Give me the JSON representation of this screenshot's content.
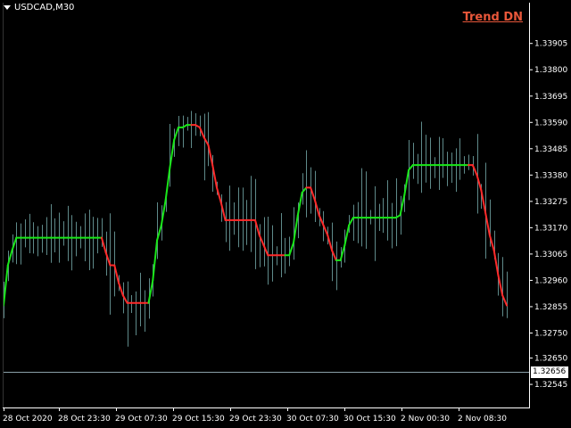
{
  "header": {
    "symbol": "USDCAD,M30"
  },
  "indicator": {
    "label": "Trend DN",
    "label_color": "#e8573a"
  },
  "colors": {
    "background": "#000000",
    "bars": "#5f8a8a",
    "trend_up": "#19e619",
    "trend_down": "#ff2a2a",
    "axis": "#ffffff",
    "bid_line": "#8aa0a8"
  },
  "current_price": "1.32656",
  "chart_data": {
    "type": "line",
    "title": "",
    "xlabel": "",
    "ylabel": "",
    "ylim": [
      1.3246,
      1.34
    ],
    "y_ticks": [
      "1.33905",
      "1.33800",
      "1.33695",
      "1.33590",
      "1.33485",
      "1.33380",
      "1.33275",
      "1.33170",
      "1.33065",
      "1.32960",
      "1.32855",
      "1.32750",
      "1.32650",
      "1.32545"
    ],
    "x_ticks": [
      "28 Oct 2020",
      "28 Oct 23:30",
      "29 Oct 07:30",
      "29 Oct 15:30",
      "29 Oct 23:30",
      "30 Oct 07:30",
      "30 Oct 15:30",
      "2 Nov 00:30",
      "2 Nov 08:30"
    ],
    "series": [
      {
        "values": [
          1.3286,
          1.3302,
          1.3308,
          1.3313,
          1.3313,
          1.3313,
          1.3313,
          1.3313,
          1.3313,
          1.3313,
          1.3313,
          1.3313,
          1.3313,
          1.3313,
          1.3313,
          1.3313,
          1.3313,
          1.3313,
          1.3313,
          1.3313,
          1.3313,
          1.3313,
          1.3313,
          1.3313,
          1.3307,
          1.3302,
          1.3302,
          1.3295,
          1.329,
          1.3287,
          1.3287,
          1.3287,
          1.3287,
          1.3287,
          1.3287,
          1.3296,
          1.3312,
          1.3318,
          1.3328,
          1.3341,
          1.3352,
          1.3357,
          1.3357,
          1.3358,
          1.3358,
          1.3358,
          1.3357,
          1.3353,
          1.335,
          1.3342,
          1.3333,
          1.3327,
          1.332,
          1.332,
          1.332,
          1.332,
          1.332,
          1.332,
          1.332,
          1.332,
          1.3314,
          1.331,
          1.3306,
          1.3306,
          1.3306,
          1.3306,
          1.3306,
          1.3306,
          1.3311,
          1.3322,
          1.3331,
          1.3333,
          1.3333,
          1.3328,
          1.3322,
          1.3318,
          1.3314,
          1.3308,
          1.3304,
          1.3304,
          1.331,
          1.3318,
          1.3321,
          1.3321,
          1.3321,
          1.3321,
          1.3321,
          1.3321,
          1.3321,
          1.3321,
          1.3321,
          1.3321,
          1.3321,
          1.3322,
          1.333,
          1.334,
          1.3342,
          1.3342,
          1.3342,
          1.3342,
          1.3342,
          1.3342,
          1.3342,
          1.3342,
          1.3342,
          1.3342,
          1.3342,
          1.3342,
          1.3342,
          1.3342,
          1.3342,
          1.3338,
          1.3332,
          1.3323,
          1.3314,
          1.3308,
          1.3298,
          1.329,
          1.3286
        ],
        "trend": [
          "up",
          "up",
          "up",
          "up",
          "up",
          "up",
          "up",
          "up",
          "up",
          "up",
          "up",
          "up",
          "up",
          "up",
          "up",
          "up",
          "up",
          "up",
          "up",
          "up",
          "up",
          "up",
          "up",
          "up",
          "dn",
          "dn",
          "dn",
          "dn",
          "dn",
          "dn",
          "dn",
          "dn",
          "dn",
          "dn",
          "dn",
          "up",
          "up",
          "up",
          "up",
          "up",
          "up",
          "up",
          "up",
          "up",
          "up",
          "dn",
          "dn",
          "dn",
          "dn",
          "dn",
          "dn",
          "dn",
          "dn",
          "dn",
          "dn",
          "dn",
          "dn",
          "dn",
          "dn",
          "dn",
          "dn",
          "dn",
          "dn",
          "dn",
          "dn",
          "dn",
          "dn",
          "up",
          "up",
          "up",
          "up",
          "up",
          "dn",
          "dn",
          "dn",
          "dn",
          "dn",
          "dn",
          "dn",
          "up",
          "up",
          "up",
          "up",
          "up",
          "up",
          "up",
          "up",
          "up",
          "up",
          "up",
          "up",
          "up",
          "up",
          "up",
          "up",
          "up",
          "up",
          "up",
          "up",
          "up",
          "up",
          "up",
          "up",
          "up",
          "up",
          "up",
          "up",
          "up",
          "up",
          "up",
          "dn",
          "dn",
          "dn",
          "dn",
          "dn",
          "dn",
          "dn",
          "dn",
          "dn"
        ]
      }
    ]
  }
}
